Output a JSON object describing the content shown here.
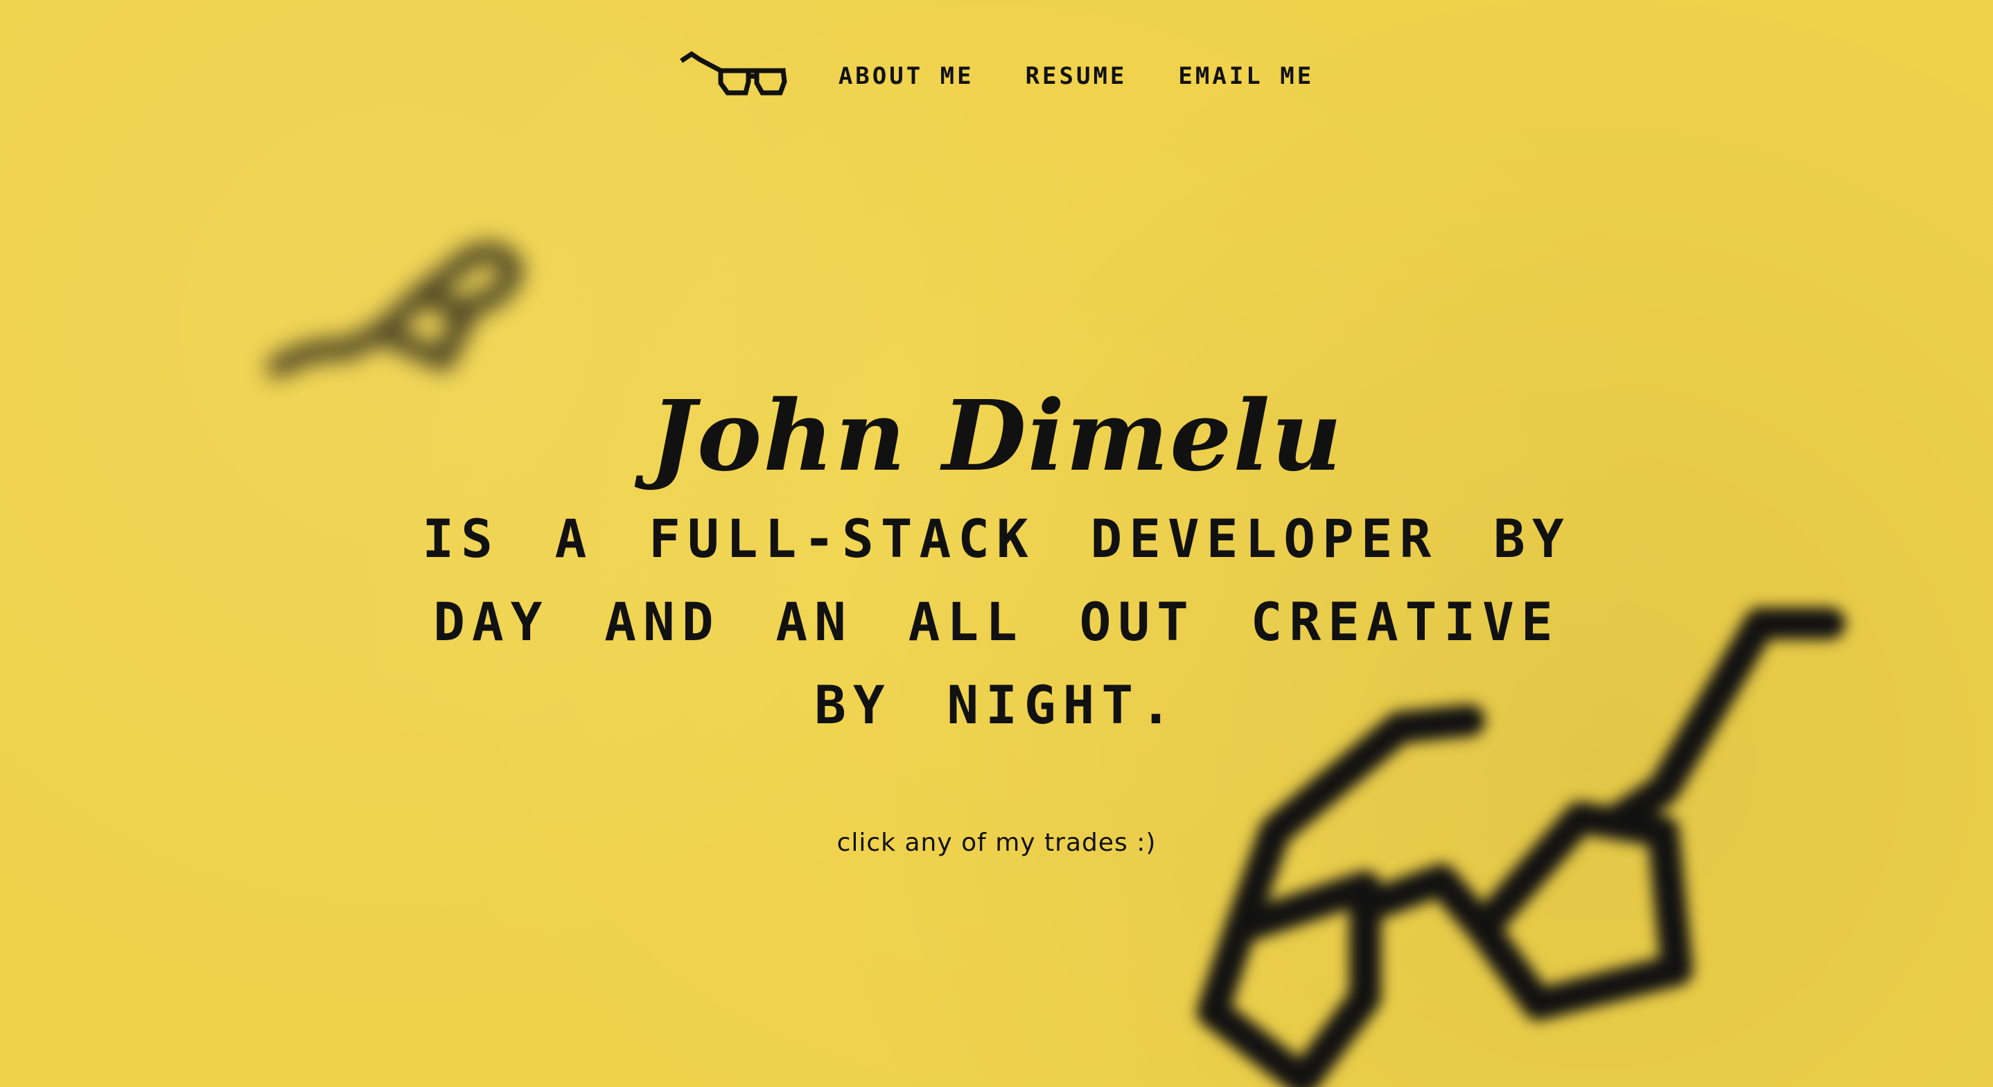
{
  "nav": {
    "logo_icon": "glasses-icon",
    "links": [
      {
        "label": "ABOUT ME"
      },
      {
        "label": "RESUME"
      },
      {
        "label": "EMAIL ME"
      }
    ]
  },
  "hero": {
    "name": "John Dimelu",
    "tagline": "IS A FULL-STACK DEVELOPER BY DAY AND AN ALL OUT CREATIVE BY NIGHT.",
    "hint": "click any of my trades :)"
  },
  "colors": {
    "background": "#efd14a",
    "text": "#111111"
  }
}
